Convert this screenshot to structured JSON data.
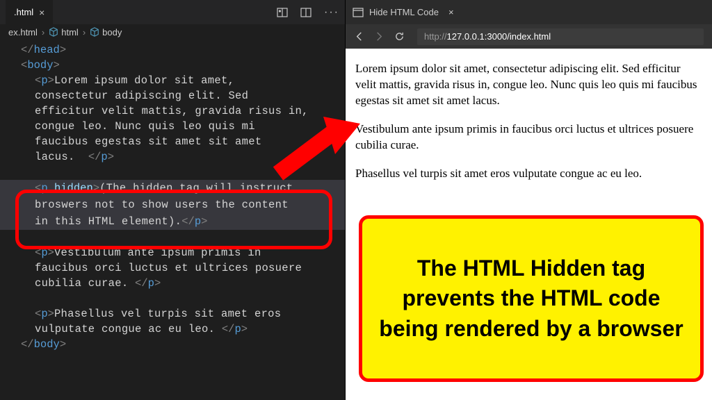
{
  "editor": {
    "tab_label": ".html",
    "breadcrumb": {
      "file": "ex.html",
      "path1": "html",
      "path2": "body"
    },
    "code": {
      "head_close": "</head>",
      "body_open": "<body>",
      "body_close": "</body>",
      "p_open": "<p>",
      "p_close": "</p>",
      "p_hidden_open": "<p hidden>",
      "para1_l1": "Lorem ipsum dolor sit amet,",
      "para1_l2": "consectetur adipiscing elit. Sed",
      "para1_l3": "efficitur velit mattis, gravida risus in,",
      "para1_l4": "congue leo. Nunc quis leo quis mi",
      "para1_l5": "faucibus egestas sit amet sit amet",
      "para1_l6": "lacus.  ",
      "hidden_l1": "(The hidden tag will instruct",
      "hidden_l2": "broswers not to show users the content",
      "hidden_l3": "in this HTML element).",
      "para3_l1": "Vestibulum ante ipsum primis in",
      "para3_l2": "faucibus orci luctus et ultrices posuere",
      "para3_l3": "cubilia curae. ",
      "para4_l1": "Phasellus vel turpis sit amet eros",
      "para4_l2": "vulputate congue ac eu leo. "
    }
  },
  "browser": {
    "tab_label": "Hide HTML Code",
    "url_prefix": "http://",
    "url_main": "127.0.0.1:3000/index.html",
    "paragraph1": "Lorem ipsum dolor sit amet, consectetur adipiscing elit. Sed efficitur velit mattis, gravida risus in, congue leo. Nunc quis leo quis mi faucibus egestas sit amet sit amet lacus.",
    "paragraph2": "Vestibulum ante ipsum primis in faucibus orci luctus et ultrices posuere cubilia curae.",
    "paragraph3": "Phasellus vel turpis sit amet eros vulputate congue ac eu leo."
  },
  "callout": {
    "text": "The HTML Hidden tag prevents the HTML code being rendered by a browser"
  }
}
